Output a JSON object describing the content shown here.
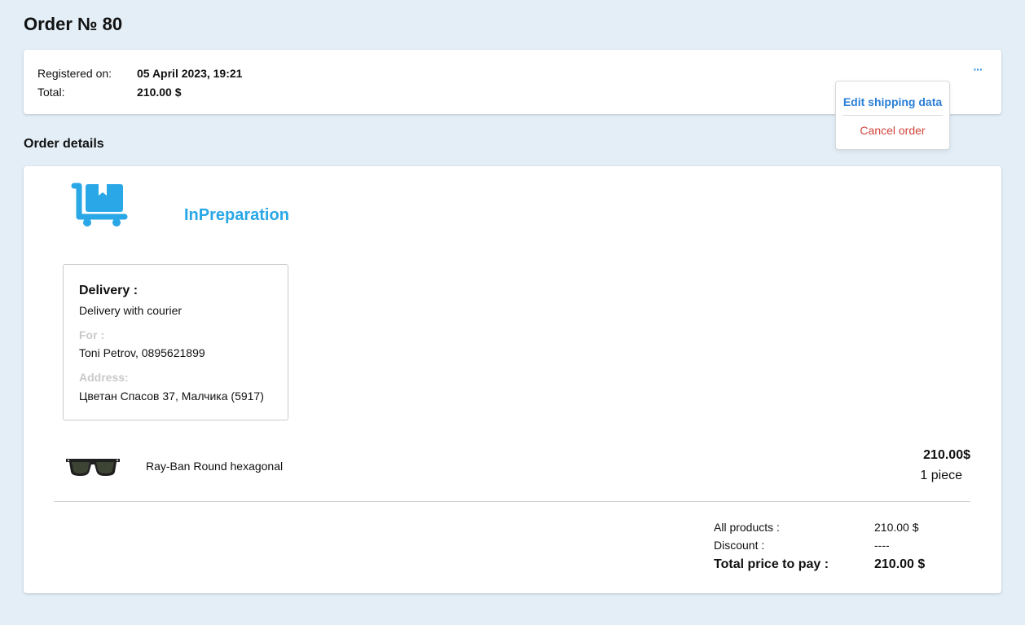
{
  "page": {
    "title": "Order № 80"
  },
  "summary": {
    "registered_label": "Registered on:",
    "registered_value": "05 April 2023, 19:21",
    "total_label": "Total:",
    "total_value": "210.00 $",
    "more_label": "···"
  },
  "menu": {
    "edit_label": "Edit shipping data",
    "cancel_label": "Cancel order"
  },
  "details": {
    "section_title": "Order details",
    "status": "InPreparation",
    "status_icon": "cart-icon",
    "delivery": {
      "title": "Delivery :",
      "method": "Delivery with courier",
      "for_label": "For :",
      "for_value": "Toni Petrov, 0895621899",
      "address_label": "Address:",
      "address_value": "Цветан Спасов 37, Малчика (5917)"
    },
    "product": {
      "image_icon": "sunglasses-icon",
      "name": "Ray-Ban Round hexagonal",
      "price": "210.00$",
      "quantity": "1 piece"
    },
    "totals": {
      "all_products_label": "All products :",
      "all_products_value": "210.00 $",
      "discount_label": "Discount :",
      "discount_value": "----",
      "total_label": "Total price to pay :",
      "total_value": "210.00 $"
    }
  },
  "colors": {
    "background": "#e3eef7",
    "accent": "#29a7e6",
    "link": "#2a7fd6",
    "danger": "#d0453a"
  }
}
